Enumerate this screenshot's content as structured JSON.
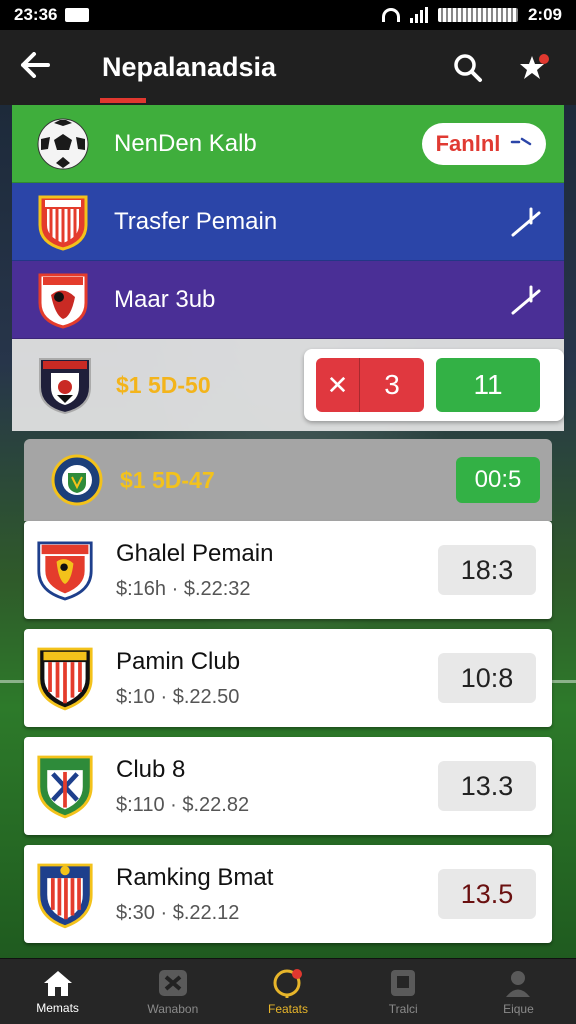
{
  "status": {
    "time": "23:36",
    "right_time": "2:09"
  },
  "header": {
    "title": "Nepalanadsia"
  },
  "bands": [
    {
      "label": "NenDen Kalb",
      "color": "#3fae3c",
      "pill_text": "Fanlnl",
      "pill_icon": "chevron-icon"
    },
    {
      "label": "Trasfer Pemain",
      "color": "#2b45a8",
      "icon": "check-icon"
    },
    {
      "label": "Maar 3ub",
      "color": "#4a2f96",
      "icon": "check-icon"
    }
  ],
  "score_row": {
    "label": "$1 5D-50",
    "red_value": "3",
    "green_value": "11"
  },
  "grey_row": {
    "label": "$1 5D-47",
    "value": "00:5"
  },
  "cards": [
    {
      "name": "Ghalel Pemain",
      "meta": "$:16h · $.22:32",
      "value": "18:3"
    },
    {
      "name": "Pamin Club",
      "meta": "$:10 · $.22.50",
      "value": "10:8"
    },
    {
      "name": "Club 8",
      "meta": "$:110 · $.22.82",
      "value": "13.3"
    },
    {
      "name": "Ramking Bmat",
      "meta": "$:30 · $.22.12",
      "value": "13.5"
    }
  ],
  "nav": [
    {
      "label": "Memats",
      "icon": "home-icon"
    },
    {
      "label": "Wanabon",
      "icon": "tools-icon"
    },
    {
      "label": "Featats",
      "icon": "ball-icon"
    },
    {
      "label": "Tralci",
      "icon": "square-icon"
    },
    {
      "label": "Eique",
      "icon": "person-icon"
    }
  ],
  "colors": {
    "accent": "#e0382f",
    "green": "#33b145",
    "gold": "#f3b41b"
  }
}
